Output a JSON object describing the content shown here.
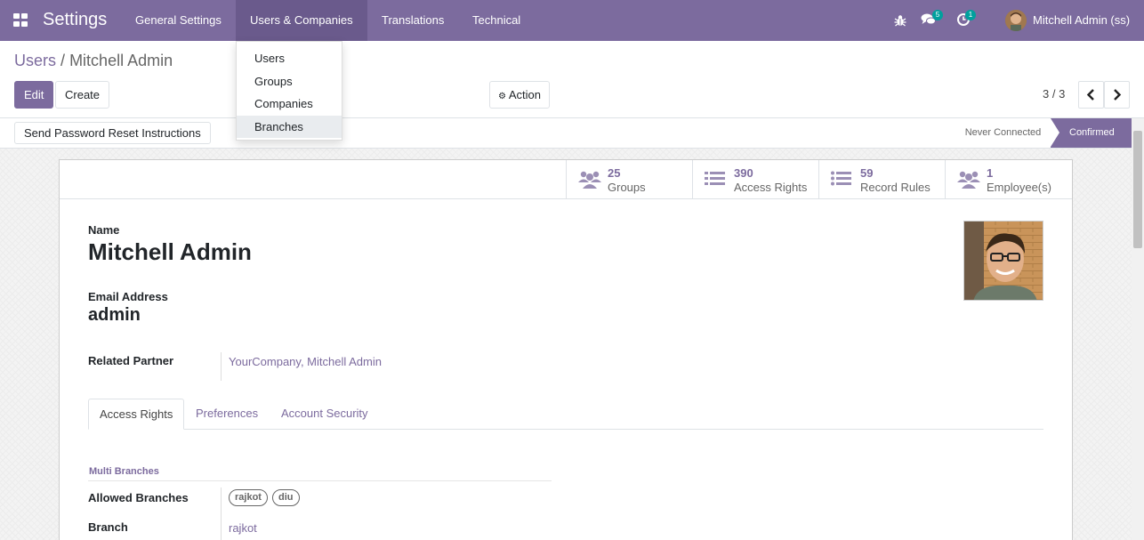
{
  "navbar": {
    "app_title": "Settings",
    "menus": [
      "General Settings",
      "Users & Companies",
      "Translations",
      "Technical"
    ],
    "messages_count": "5",
    "activities_count": "1",
    "user_name": "Mitchell Admin (ss)"
  },
  "dropdown": {
    "items": [
      "Users",
      "Groups",
      "Companies",
      "Branches"
    ]
  },
  "breadcrumb": {
    "parent": "Users",
    "separator": "/",
    "current": "Mitchell Admin"
  },
  "buttons": {
    "edit": "Edit",
    "create": "Create",
    "action": "Action",
    "send_reset": "Send Password Reset Instructions"
  },
  "pager": {
    "value": "3 / 3"
  },
  "status": {
    "inactive": "Never Connected",
    "active": "Confirmed"
  },
  "stats": [
    {
      "value": "25",
      "label": "Groups",
      "icon": "users-icon"
    },
    {
      "value": "390",
      "label": "Access Rights",
      "icon": "list-icon"
    },
    {
      "value": "59",
      "label": "Record Rules",
      "icon": "list-icon"
    },
    {
      "value": "1",
      "label": "Employee(s)",
      "icon": "users-icon"
    }
  ],
  "form": {
    "name_label": "Name",
    "name_value": "Mitchell Admin",
    "email_label": "Email Address",
    "email_value": "admin",
    "partner_label": "Related Partner",
    "partner_value": "YourCompany, Mitchell Admin"
  },
  "tabs": [
    "Access Rights",
    "Preferences",
    "Account Security"
  ],
  "access": {
    "section_title": "Multi Branches",
    "allowed_label": "Allowed Branches",
    "allowed_tags": [
      "rajkot",
      "diu"
    ],
    "branch_label": "Branch",
    "branch_value": "rajkot"
  },
  "colors": {
    "brand": "#7C6B9E",
    "badge": "#00A09D"
  }
}
